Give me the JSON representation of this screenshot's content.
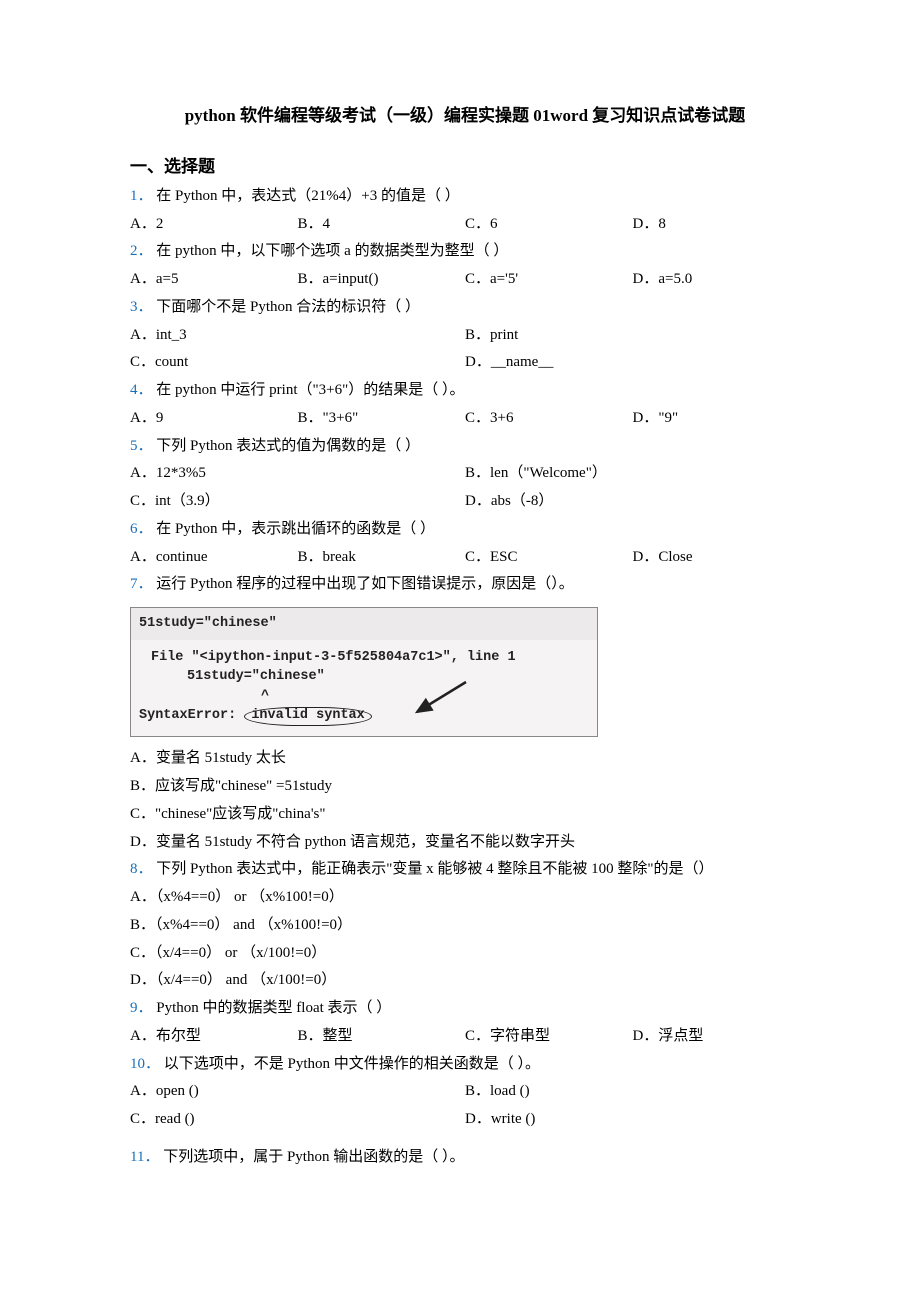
{
  "title": "python 软件编程等级考试（一级）编程实操题 01word 复习知识点试卷试题",
  "section_heading": "一、选择题",
  "questions": [
    {
      "num": "1．",
      "stem": "在 Python 中，表达式（21%4）+3 的值是（  ）",
      "layout": "opt4",
      "opts": [
        "A．2",
        "B．4",
        "C．6",
        "D．8"
      ]
    },
    {
      "num": "2．",
      "stem": "在 python 中，以下哪个选项 a 的数据类型为整型（  ）",
      "layout": "opt4",
      "opts": [
        "A．a=5",
        "B．a=input()",
        "C．a='5'",
        "D．a=5.0"
      ]
    },
    {
      "num": "3．",
      "stem": "下面哪个不是 Python 合法的标识符（  ）",
      "layout": "opt2",
      "opts": [
        "A．int_3",
        "B．print",
        "C．count",
        "D．__name__"
      ]
    },
    {
      "num": "4．",
      "stem": "在 python 中运行 print（\"3+6\"）的结果是（    ）。",
      "layout": "opt4",
      "opts": [
        "A．9",
        "B．\"3+6\"",
        "C．3+6",
        "D．\"9\""
      ]
    },
    {
      "num": "5．",
      "stem": "下列 Python 表达式的值为偶数的是（  ）",
      "layout": "opt2",
      "opts": [
        "A．12*3%5",
        "B．len（\"Welcome\"）",
        "C．int（3.9）",
        "D．abs（-8）"
      ]
    },
    {
      "num": "6．",
      "stem": "在 Python 中，表示跳出循环的函数是（    ）",
      "layout": "opt4",
      "opts": [
        "A．continue",
        "B．break",
        "C．ESC",
        "D．Close"
      ]
    },
    {
      "num": "7．",
      "stem": "运行 Python 程序的过程中出现了如下图错误提示，原因是（）。",
      "code": {
        "line0": "51study=\"chinese\"",
        "trace1": "File \"<ipython-input-3-5f525804a7c1>\", line 1",
        "trace2": "51study=\"chinese\"",
        "caret": "^",
        "err_prefix": "SyntaxError:",
        "err_oval": "invalid syntax"
      },
      "layout": "opt1",
      "opts": [
        "A．变量名 51study 太长",
        "B．应该写成\"chinese\" =51study",
        "C．\"chinese\"应该写成\"china's\"",
        "D．变量名 51study 不符合 python 语言规范，变量名不能以数字开头"
      ]
    },
    {
      "num": "8．",
      "stem": "下列 Python 表达式中，能正确表示\"变量 x 能够被 4 整除且不能被 100 整除\"的是（）",
      "layout": "opt1",
      "opts": [
        "A．（x%4==0） or （x%100!=0）",
        "B．（x%4==0） and （x%100!=0）",
        "C．（x/4==0） or （x/100!=0）",
        "D．（x/4==0） and （x/100!=0）"
      ]
    },
    {
      "num": "9．",
      "stem": "Python 中的数据类型 float 表示（   ）",
      "layout": "opt4",
      "opts": [
        "A．布尔型",
        "B．整型",
        "C．字符串型",
        "D．浮点型"
      ]
    },
    {
      "num": "10．",
      "stem": "以下选项中，不是 Python 中文件操作的相关函数是（  ）。",
      "layout": "opt2",
      "opts": [
        "A．open ()",
        "B．load ()",
        "C．read ()",
        "D．write ()"
      ]
    },
    {
      "num": "11．",
      "stem": "下列选项中，属于 Python 输出函数的是（ ）。",
      "layout": "none",
      "opts": []
    }
  ]
}
